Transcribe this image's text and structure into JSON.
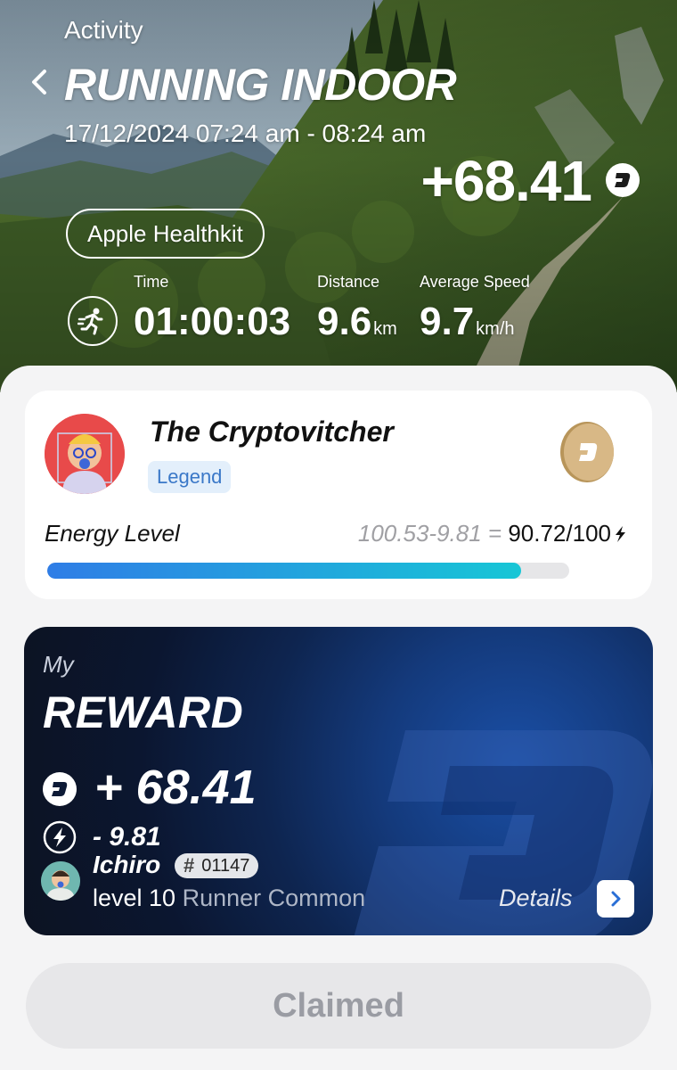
{
  "header": {
    "section_label": "Activity",
    "title": "RUNNING INDOOR",
    "datetime": "17/12/2024 07:24 am - 08:24 am",
    "reward": "+68.41",
    "source": "Apple Healthkit"
  },
  "stats": {
    "time": {
      "label": "Time",
      "value": "01:00:03"
    },
    "distance": {
      "label": "Distance",
      "value": "9.6",
      "unit": "km"
    },
    "speed": {
      "label": "Average Speed",
      "value": "9.7",
      "unit": "km/h"
    }
  },
  "profile": {
    "name": "The Cryptovitcher",
    "rank": "Legend",
    "energy": {
      "label": "Energy Level",
      "before": "100.53",
      "cost": "9.81",
      "result": "90.72/100",
      "fill_fraction": 0.9072
    }
  },
  "reward_card": {
    "my_label": "My",
    "title": "REWARD",
    "token_amount": "+ 68.41",
    "energy_amount": "- 9.81",
    "runner": {
      "name": "Ichiro",
      "id_hash": "#",
      "id": "01147",
      "level": "level 10",
      "class": "Runner Common"
    },
    "details_label": "Details"
  },
  "claim_button": {
    "label": "Claimed",
    "state": "disabled"
  },
  "colors": {
    "energy_gradient_start": "#2f7de6",
    "energy_gradient_end": "#17c6d6",
    "rank_badge_text": "#3a78c8",
    "reward_card_bg": "#0b1630"
  }
}
